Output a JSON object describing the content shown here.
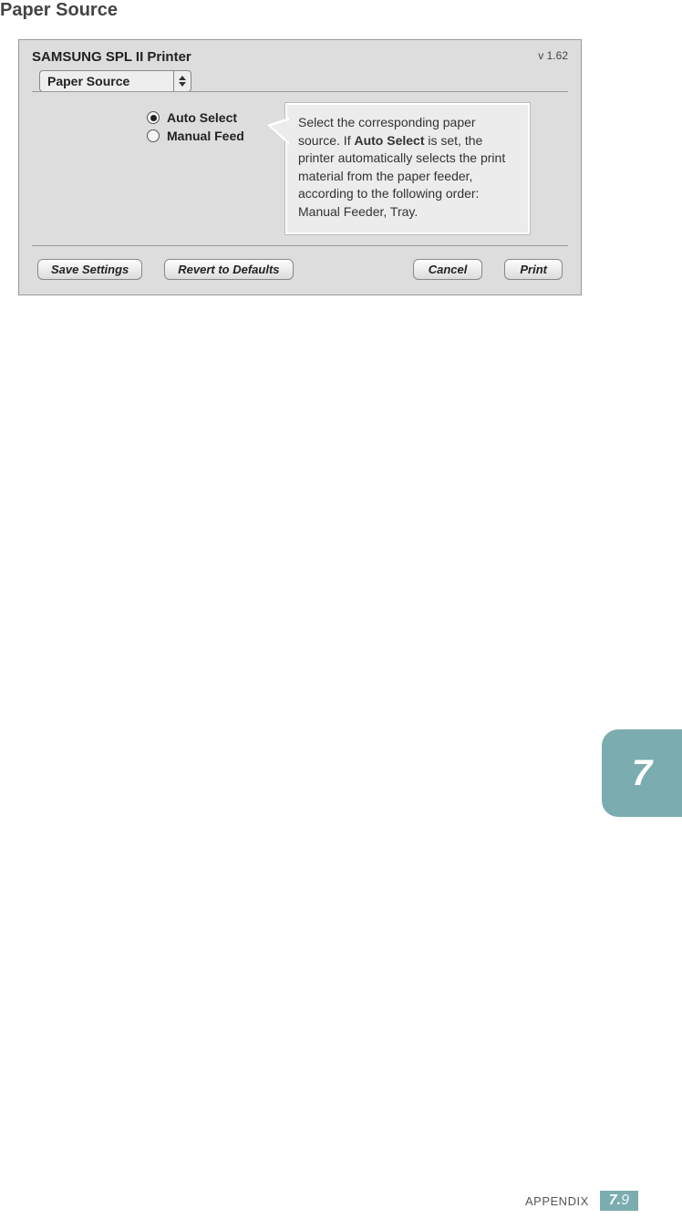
{
  "heading": "Paper Source",
  "dialog": {
    "title": "SAMSUNG SPL II Printer",
    "version": "v 1.62",
    "dropdown_label": "Paper Source",
    "radios": {
      "auto_select": "Auto Select",
      "manual_feed": "Manual Feed"
    },
    "callout_pre": "Select the corresponding paper source. If ",
    "callout_bold": "Auto Select",
    "callout_post": " is set, the printer automatically selects the print material from the paper feeder, according to the following order: Manual Feeder, Tray.",
    "buttons": {
      "save": "Save Settings",
      "revert": "Revert to Defaults",
      "cancel": "Cancel",
      "print": "Print"
    }
  },
  "side_tab": "7",
  "footer": {
    "section": "APPENDIX",
    "chapter": "7.",
    "page": "9"
  }
}
